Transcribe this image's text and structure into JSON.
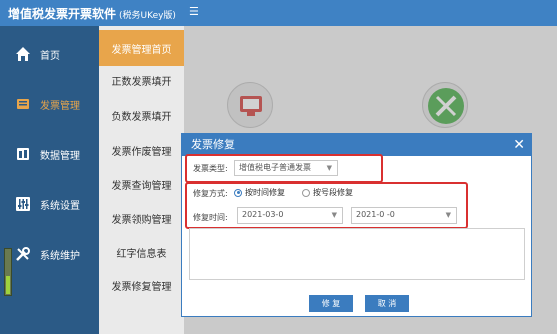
{
  "app": {
    "title": "增值税发票开票软件",
    "subtitle": "(税务UKey版)",
    "menu_icon": "menu-icon"
  },
  "sidebar": {
    "items": [
      {
        "label": "首页",
        "icon": "home-icon"
      },
      {
        "label": "发票管理",
        "icon": "invoice-icon",
        "active": true
      },
      {
        "label": "数据管理",
        "icon": "data-icon"
      },
      {
        "label": "系统设置",
        "icon": "settings-icon"
      },
      {
        "label": "系统维护",
        "icon": "maintenance-icon"
      }
    ]
  },
  "subnav": {
    "items": [
      {
        "label": "发票管理首页",
        "active": true
      },
      {
        "label": "正数发票填开"
      },
      {
        "label": "负数发票填开"
      },
      {
        "label": "发票作废管理"
      },
      {
        "label": "发票查询管理"
      },
      {
        "label": "发票领购管理"
      },
      {
        "label": "红字信息表"
      },
      {
        "label": "发票修复管理"
      }
    ]
  },
  "dialog": {
    "title": "发票修复",
    "close": "✕",
    "invoice_type_label": "发票类型:",
    "invoice_type_value": "增值税电子普通发票",
    "repair_mode_label": "修复方式:",
    "repair_by_time": "按时间修复",
    "repair_by_segment": "按号段修复",
    "repair_time_label": "修复时间:",
    "start_date": "2021-03-0",
    "end_date": "2021-0 -0",
    "confirm_label": "修 复",
    "cancel_label": "取 消"
  },
  "colors": {
    "header": "#3f82c4",
    "sidebar": "#2b5a86",
    "accent": "#e8a54b",
    "dialog": "#3b7cbf",
    "highlight": "#d93030"
  }
}
